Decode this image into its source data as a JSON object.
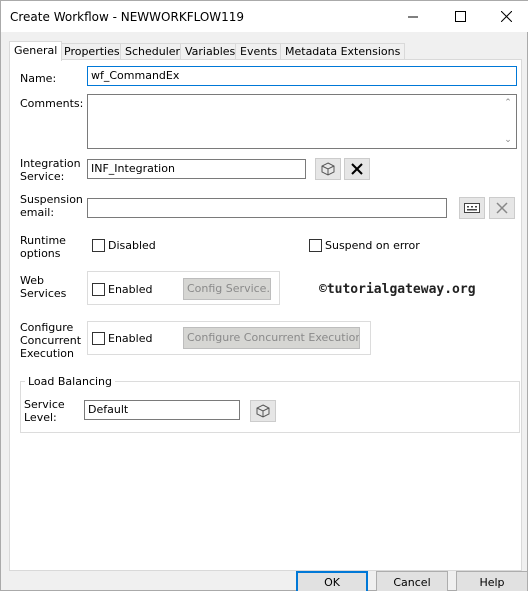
{
  "window": {
    "title": "Create Workflow - NEWWORKFLOW119"
  },
  "tabs": [
    "General",
    "Properties",
    "Scheduler",
    "Variables",
    "Events",
    "Metadata Extensions"
  ],
  "form": {
    "name_label": "Name:",
    "name_value": "wf_CommandEx",
    "comments_label": "Comments:",
    "comments_value": "",
    "integration_label_1": "Integration",
    "integration_label_2": "Service:",
    "integration_value": "INF_Integration",
    "suspension_label_1": "Suspension",
    "suspension_label_2": "email:",
    "suspension_value": "",
    "runtime_label_1": "Runtime",
    "runtime_label_2": "options",
    "disabled_label": "Disabled",
    "suspend_on_error_label": "Suspend on error",
    "web_label_1": "Web",
    "web_label_2": "Services",
    "web_enabled_label": "Enabled",
    "config_service_label": "Config Service...",
    "concurrent_label_1": "Configure",
    "concurrent_label_2": "Concurrent",
    "concurrent_label_3": "Execution",
    "concurrent_enabled_label": "Enabled",
    "configure_concurrent_label": "Configure Concurrent Execution ...",
    "load_balancing_title": "Load Balancing",
    "service_level_label_1": "Service",
    "service_level_label_2": "Level:",
    "service_level_value": "Default"
  },
  "watermark": "©tutorialgateway.org",
  "buttons": {
    "ok": "OK",
    "cancel": "Cancel",
    "help": "Help"
  },
  "icons": {
    "minimize": "minimize-icon",
    "maximize": "maximize-icon",
    "close": "close-icon",
    "browse": "cube-browse-icon",
    "clear": "x-clear-icon",
    "email_browse": "keyboard-browse-icon"
  },
  "colors": {
    "focus_border": "#0078d7",
    "clear_icon_active": "#000000",
    "clear_icon_disabled": "#888888"
  }
}
